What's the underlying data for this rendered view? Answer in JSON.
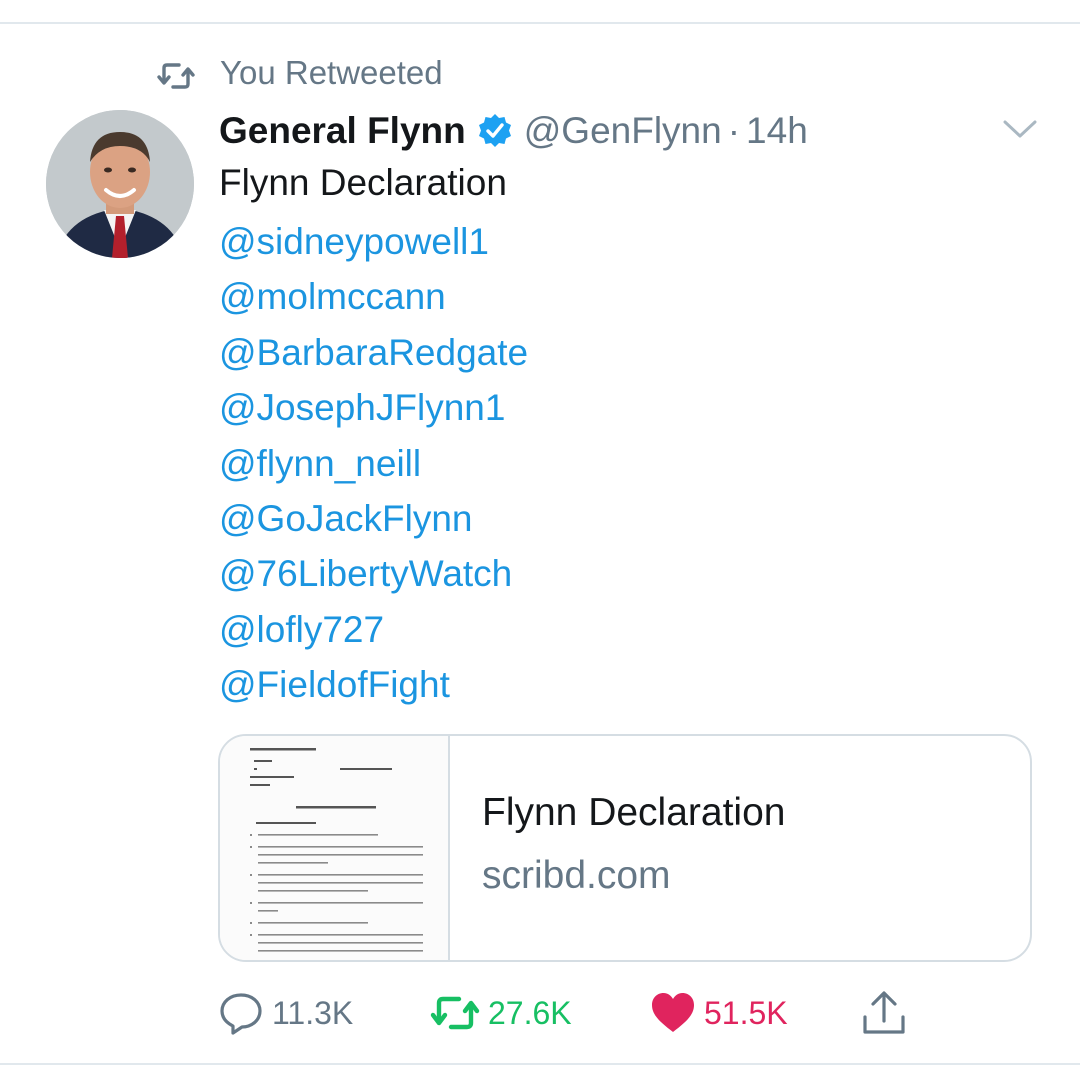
{
  "retweet_header": {
    "icon": "retweet-icon",
    "text": "You Retweeted"
  },
  "tweet": {
    "author_name": "General Flynn",
    "verified": true,
    "handle": "@GenFlynn",
    "separator": "·",
    "time": "14h",
    "text": "Flynn Declaration",
    "mentions": [
      "@sidneypowell1",
      "@molmccann",
      "@BarbaraRedgate",
      "@JosephJFlynn1",
      "@flynn_neill",
      "@GoJackFlynn",
      "@76LibertyWatch",
      "@lofly727",
      "@FieldofFight"
    ]
  },
  "link_card": {
    "title": "Flynn Declaration",
    "domain": "scribd.com",
    "thumbnail": "document-page-thumbnail"
  },
  "actions": {
    "reply_count": "11.3K",
    "retweet_count": "27.6K",
    "like_count": "51.5K"
  },
  "colors": {
    "link": "#1b95e0",
    "secondary_text": "#657786",
    "retweet_active": "#17bf63",
    "like_active": "#e0245e",
    "verified_badge": "#1da1f2",
    "divider": "#e1e8ed"
  }
}
